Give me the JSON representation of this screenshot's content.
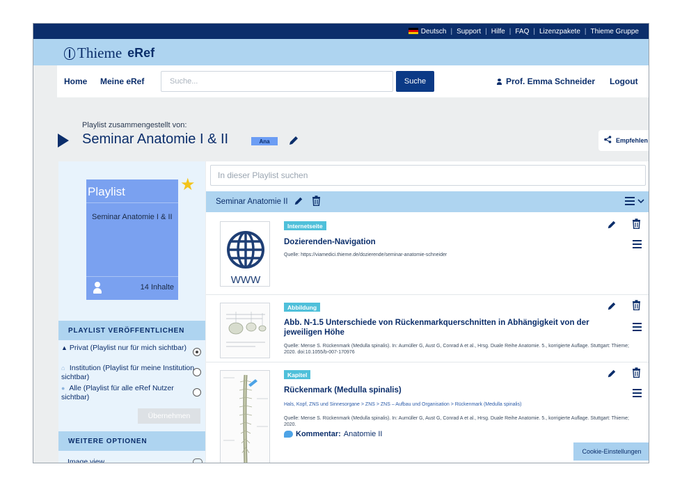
{
  "topbar": {
    "language": "Deutsch",
    "links": [
      "Support",
      "Hilfe",
      "FAQ",
      "Lizenzpakete",
      "Thieme Gruppe"
    ]
  },
  "logo": {
    "brand": "Thieme",
    "product": "eRef"
  },
  "nav": {
    "home": "Home",
    "meine": "Meine eRef",
    "search_placeholder": "Suche...",
    "search_button": "Suche",
    "user": "Prof. Emma Schneider",
    "logout": "Logout"
  },
  "playlist_header": {
    "subtitle": "Playlist zusammengestellt von:",
    "title": "Seminar Anatomie I & II",
    "badge": "Ana",
    "share": "Empfehlen"
  },
  "card": {
    "label": "Playlist",
    "name": "Seminar Anatomie I & II",
    "count": "14 Inhalte"
  },
  "publish": {
    "heading": "PLAYLIST VERÖFFENTLICHEN",
    "options": [
      {
        "label": "Privat (Playlist nur für mich sichtbar)",
        "selected": true
      },
      {
        "label": "Institution (Playlist für meine Institution sichtbar)",
        "selected": false
      },
      {
        "label": "Alle (Playlist für alle eRef Nutzer sichtbar)",
        "selected": false
      }
    ],
    "apply": "Übernehmen"
  },
  "more": {
    "heading": "WEITERE OPTIONEN",
    "image_view": "Image view"
  },
  "list": {
    "search_placeholder": "In dieser Playlist suchen",
    "title": "Seminar Anatomie II",
    "items": [
      {
        "tag": "Internetseite",
        "title": "Dozierenden-Navigation",
        "source": "Quelle: https://viamedici.thieme.de/dozierende/seminar-anatomie-schneider",
        "thumb_text": "WWW"
      },
      {
        "tag": "Abbildung",
        "title": "Abb. N-1.5 Unterschiede von Rückenmarkquerschnitten in Abhängigkeit von der jeweiligen Höhe",
        "source": "Quelle: Mense S. Rückenmark (Medulla spinalis). In: Aumüller G, Aust G, Conrad A et al., Hrsg. Duale Reihe Anatomie. 5., korrigierte Auflage. Stuttgart: Thieme; 2020. doi:10.1055/b-007-170976"
      },
      {
        "tag": "Kapitel",
        "title": "Rückenmark (Medulla spinalis)",
        "breadcrumb": "Hals, Kopf, ZNS und Sinnesorgane > ZNS > ZNS – Aufbau und Organisation > Rückenmark (Medulla spinalis)",
        "source": "Quelle: Mense S. Rückenmark (Medulla spinalis). In: Aumüller G, Aust G, Conrad A et al., Hrsg. Duale Reihe Anatomie. 5., korrigierte Auflage. Stuttgart: Thieme; 2020.",
        "comment_label": "Kommentar:",
        "comment": "Anatomie II"
      }
    ]
  },
  "cookie": "Cookie-Einstellungen",
  "colors": {
    "navy": "#0b2e6b",
    "light_blue": "#aed4f0",
    "card_blue": "#7aa1f0",
    "tag_cyan": "#4fc0da",
    "star": "#f3c41a"
  }
}
